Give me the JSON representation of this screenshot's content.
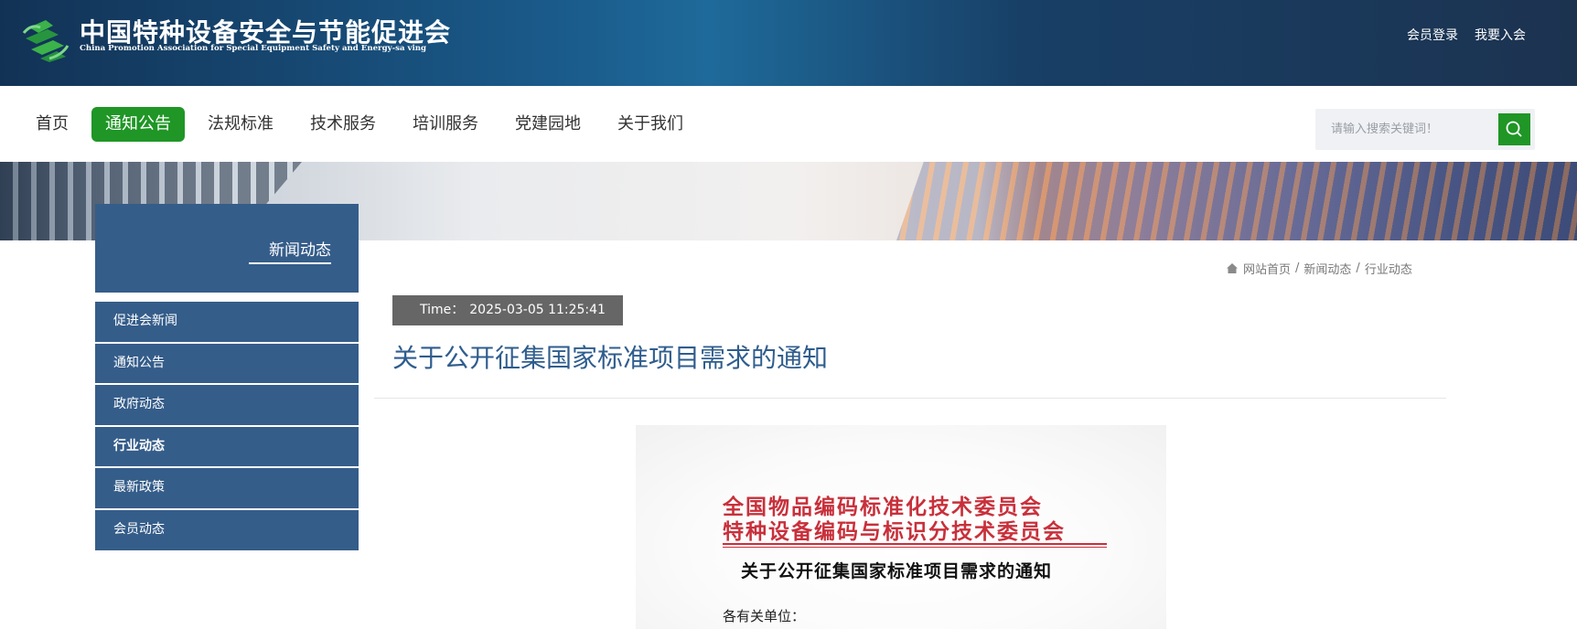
{
  "header": {
    "org_name_cn": "中国特种设备安全与节能促进会",
    "org_name_en": "China Promotion Association for Special Equipment Safety and Energy-sa ving",
    "login": "会员登录",
    "join": "我要入会"
  },
  "nav": {
    "items": [
      {
        "label": "首页"
      },
      {
        "label": "通知公告",
        "active": true
      },
      {
        "label": "法规标准"
      },
      {
        "label": "技术服务"
      },
      {
        "label": "培训服务"
      },
      {
        "label": "党建园地"
      },
      {
        "label": "关于我们"
      }
    ],
    "search_placeholder": "请输入搜索关键词！"
  },
  "sidebar": {
    "title": "新闻动态",
    "items": [
      {
        "label": "促进会新闻"
      },
      {
        "label": "通知公告"
      },
      {
        "label": "政府动态"
      },
      {
        "label": "行业动态",
        "active": true
      },
      {
        "label": "最新政策"
      },
      {
        "label": "会员动态"
      }
    ]
  },
  "breadcrumb": {
    "items": [
      "网站首页",
      "新闻动态",
      "行业动态"
    ],
    "separator": "/"
  },
  "article": {
    "time_label": "Time：",
    "time_value": "2025-03-05 11:25:41",
    "title": "关于公开征集国家标准项目需求的通知"
  },
  "document_image": {
    "org_line1": "全国物品编码标准化技术委员会",
    "org_line2": "特种设备编码与标识分技术委员会",
    "title": "关于公开征集国家标准项目需求的通知",
    "salutation": "各有关单位："
  },
  "colors": {
    "brand_green": "#1f9626",
    "sidebar_blue": "#355d8a",
    "title_blue": "#2f5d8e",
    "doc_red": "#c8303b"
  }
}
